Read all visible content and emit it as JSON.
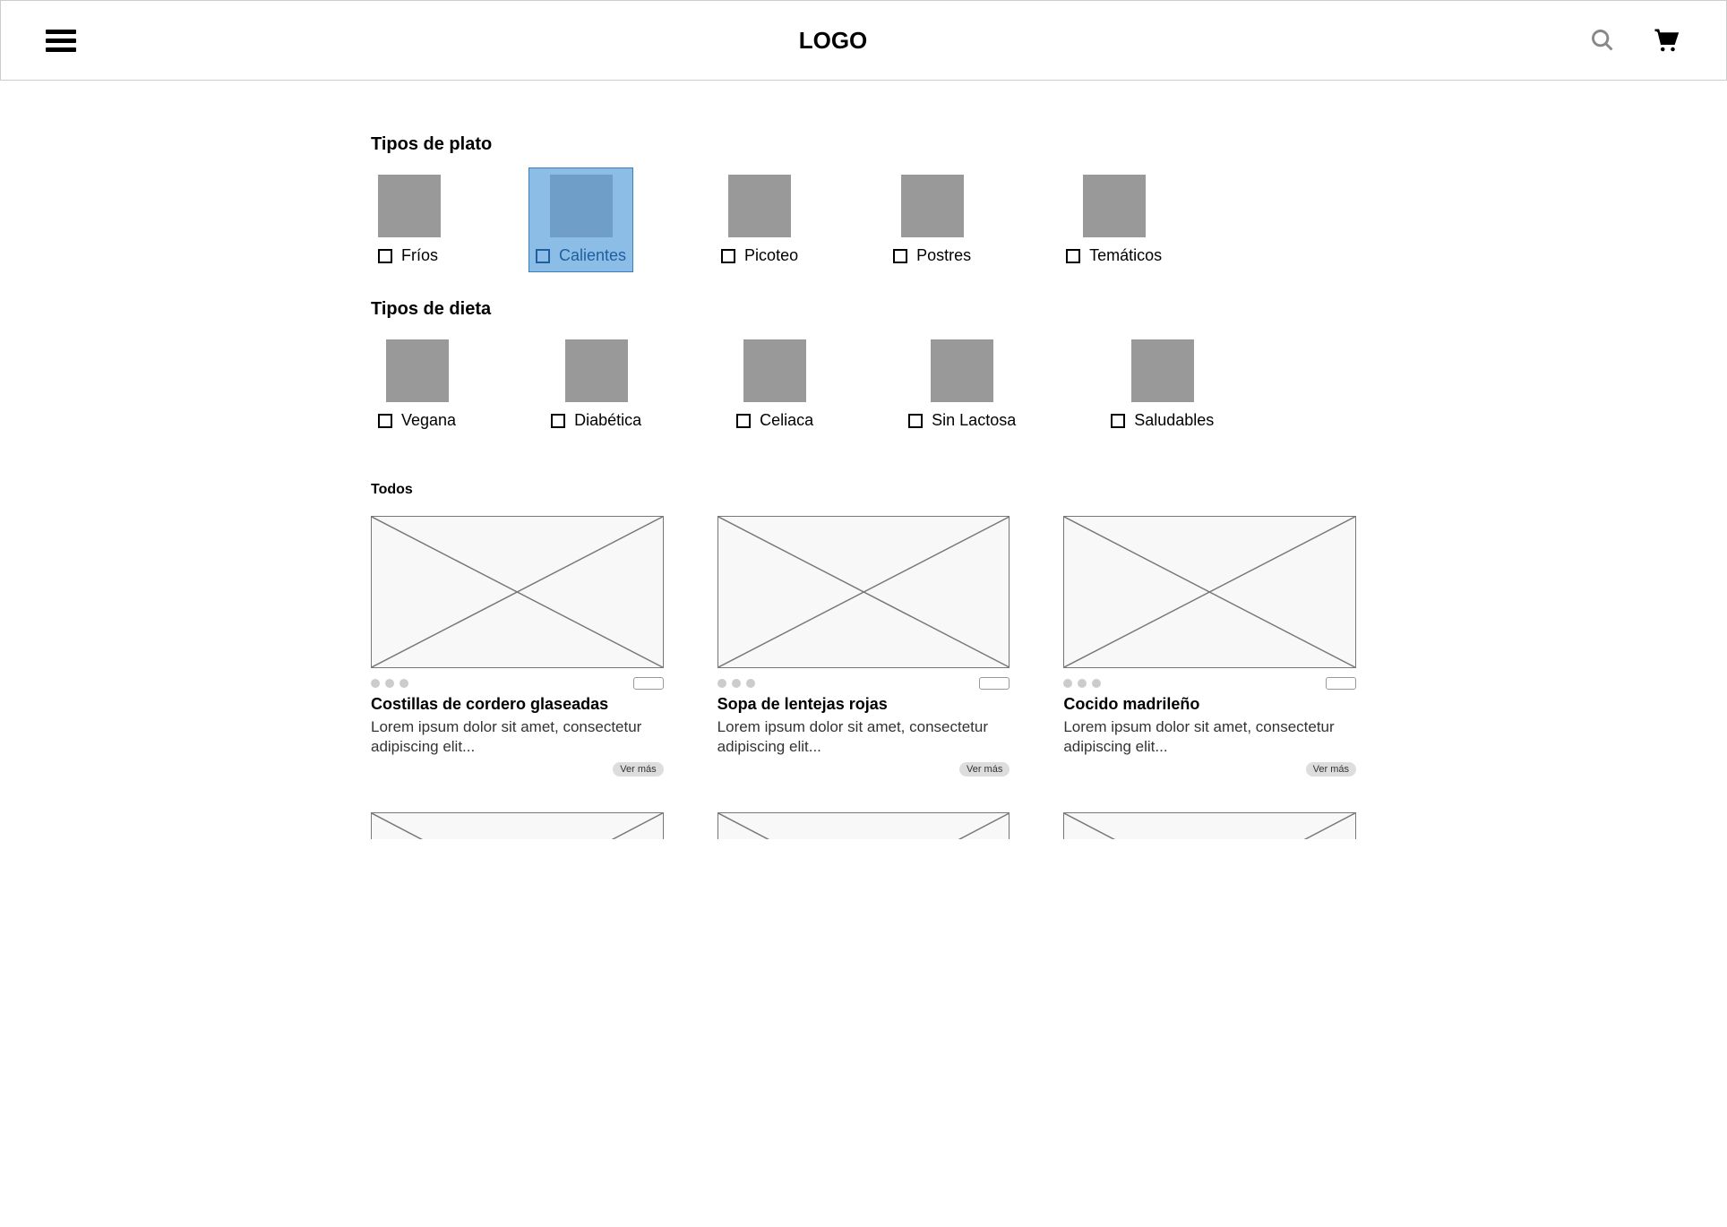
{
  "header": {
    "logo": "LOGO"
  },
  "sections": {
    "dishTypes": {
      "title": "Tipos de plato",
      "items": [
        {
          "label": "Fríos",
          "selected": false
        },
        {
          "label": "Calientes",
          "selected": true
        },
        {
          "label": "Picoteo",
          "selected": false
        },
        {
          "label": "Postres",
          "selected": false
        },
        {
          "label": "Temáticos",
          "selected": false
        }
      ]
    },
    "dietTypes": {
      "title": "Tipos de dieta",
      "items": [
        {
          "label": "Vegana",
          "selected": false
        },
        {
          "label": "Diabética",
          "selected": false
        },
        {
          "label": "Celiaca",
          "selected": false
        },
        {
          "label": "Sin Lactosa",
          "selected": false
        },
        {
          "label": "Saludables",
          "selected": false
        }
      ]
    }
  },
  "results": {
    "title": "Todos",
    "seeMoreLabel": "Ver más",
    "cards": [
      {
        "title": "Costillas de cordero glaseadas",
        "desc": "Lorem ipsum dolor sit amet, consectetur adipiscing elit..."
      },
      {
        "title": "Sopa de lentejas rojas",
        "desc": "Lorem ipsum dolor sit amet, consectetur adipiscing elit..."
      },
      {
        "title": "Cocido madrileño",
        "desc": "Lorem ipsum dolor sit amet, consectetur adipiscing elit..."
      }
    ]
  }
}
